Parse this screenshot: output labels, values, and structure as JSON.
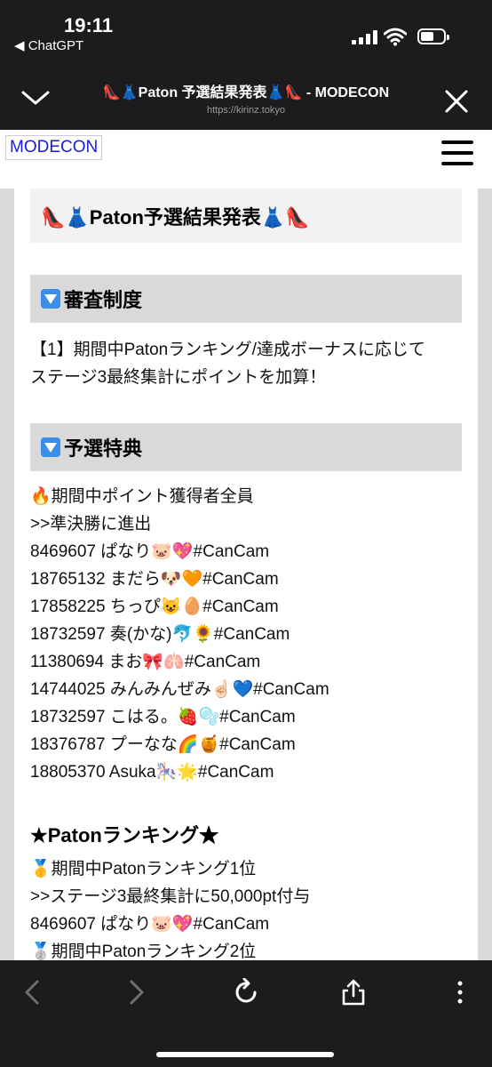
{
  "status": {
    "time": "19:11",
    "back_app": "◀ ChatGPT"
  },
  "toolbar": {
    "title": "👠👗Paton 予選結果発表👗👠 - MODECON",
    "url": "https://kirinz.tokyo"
  },
  "site": {
    "logo": "MODECON"
  },
  "article": {
    "title": "👠👗Paton予選結果発表👗👠",
    "section1": {
      "heading": "審査制度",
      "lines": [
        "【1】期間中Patonランキング/達成ボーナスに応じて",
        "ステージ3最終集計にポイントを加算！"
      ]
    },
    "section2": {
      "heading": "予選特典",
      "lines": [
        "🔥期間中ポイント獲得者全員",
        ">>準決勝に進出",
        "8469607 ぱなり🐷💖#CanCam",
        "18765132 まだら🐶🧡#CanCam",
        "17858225 ちっぴ😺🥚#CanCam",
        "18732597 奏(かな)🐬🌻#CanCam",
        "11380694 まお🎀🫁#CanCam",
        "14744025 みんみんぜみ☝🏻💙#CanCam",
        "18732597 こはる。🍓🫧#CanCam",
        "18376787 プーなな🌈🍯#CanCam",
        "18805370 Asuka🎠🌟#CanCam"
      ]
    },
    "section3": {
      "heading": "★Patonランキング★",
      "lines": [
        "🥇期間中Patonランキング1位",
        ">>ステージ3最終集計に50,000pt付与",
        "8469607 ぱなり🐷💖#CanCam"
      ],
      "cutoff_line": "🥈期間中Patonランキング2位"
    }
  },
  "colors": {
    "accent_link": "#1a1ae0",
    "section_icon": "#3a8ee6",
    "heading_bg": "#d9d9d9"
  }
}
